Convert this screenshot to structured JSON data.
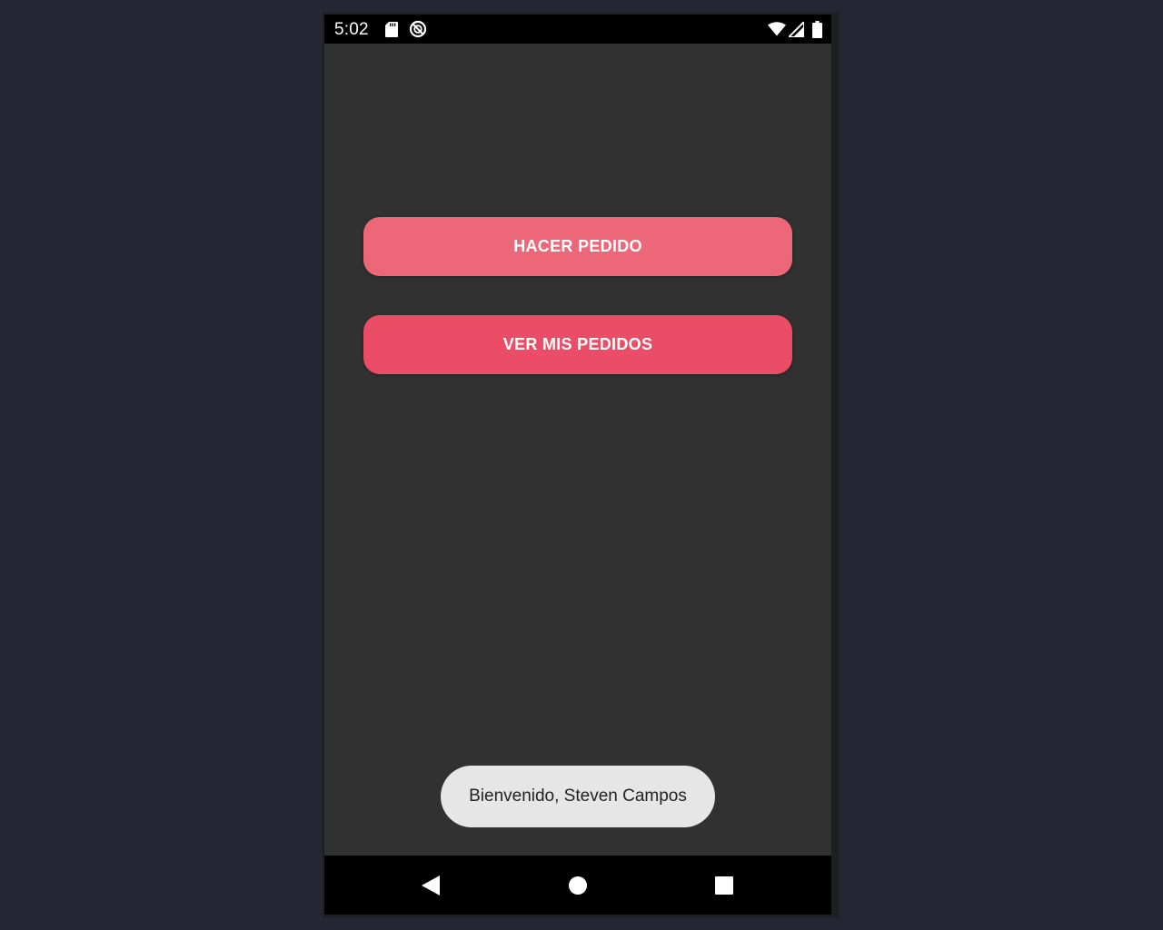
{
  "status_bar": {
    "time": "5:02",
    "icons": [
      "sd-card-icon",
      "sync-disabled-icon",
      "wifi-icon",
      "cell-signal-icon",
      "battery-icon"
    ]
  },
  "main": {
    "buttons": [
      {
        "label": "HACER PEDIDO",
        "color": "#ec6878"
      },
      {
        "label": "VER MIS PEDIDOS",
        "color": "#ea4d65"
      }
    ]
  },
  "toast": {
    "message": "Bienvenido, Steven Campos"
  },
  "nav_bar": {
    "icons": [
      "back-icon",
      "home-icon",
      "recents-icon"
    ]
  },
  "colors": {
    "page_background": "#242633",
    "screen_background": "#313131",
    "accent_primary": "#ea4d65",
    "toast_background": "#e6e6e6"
  }
}
